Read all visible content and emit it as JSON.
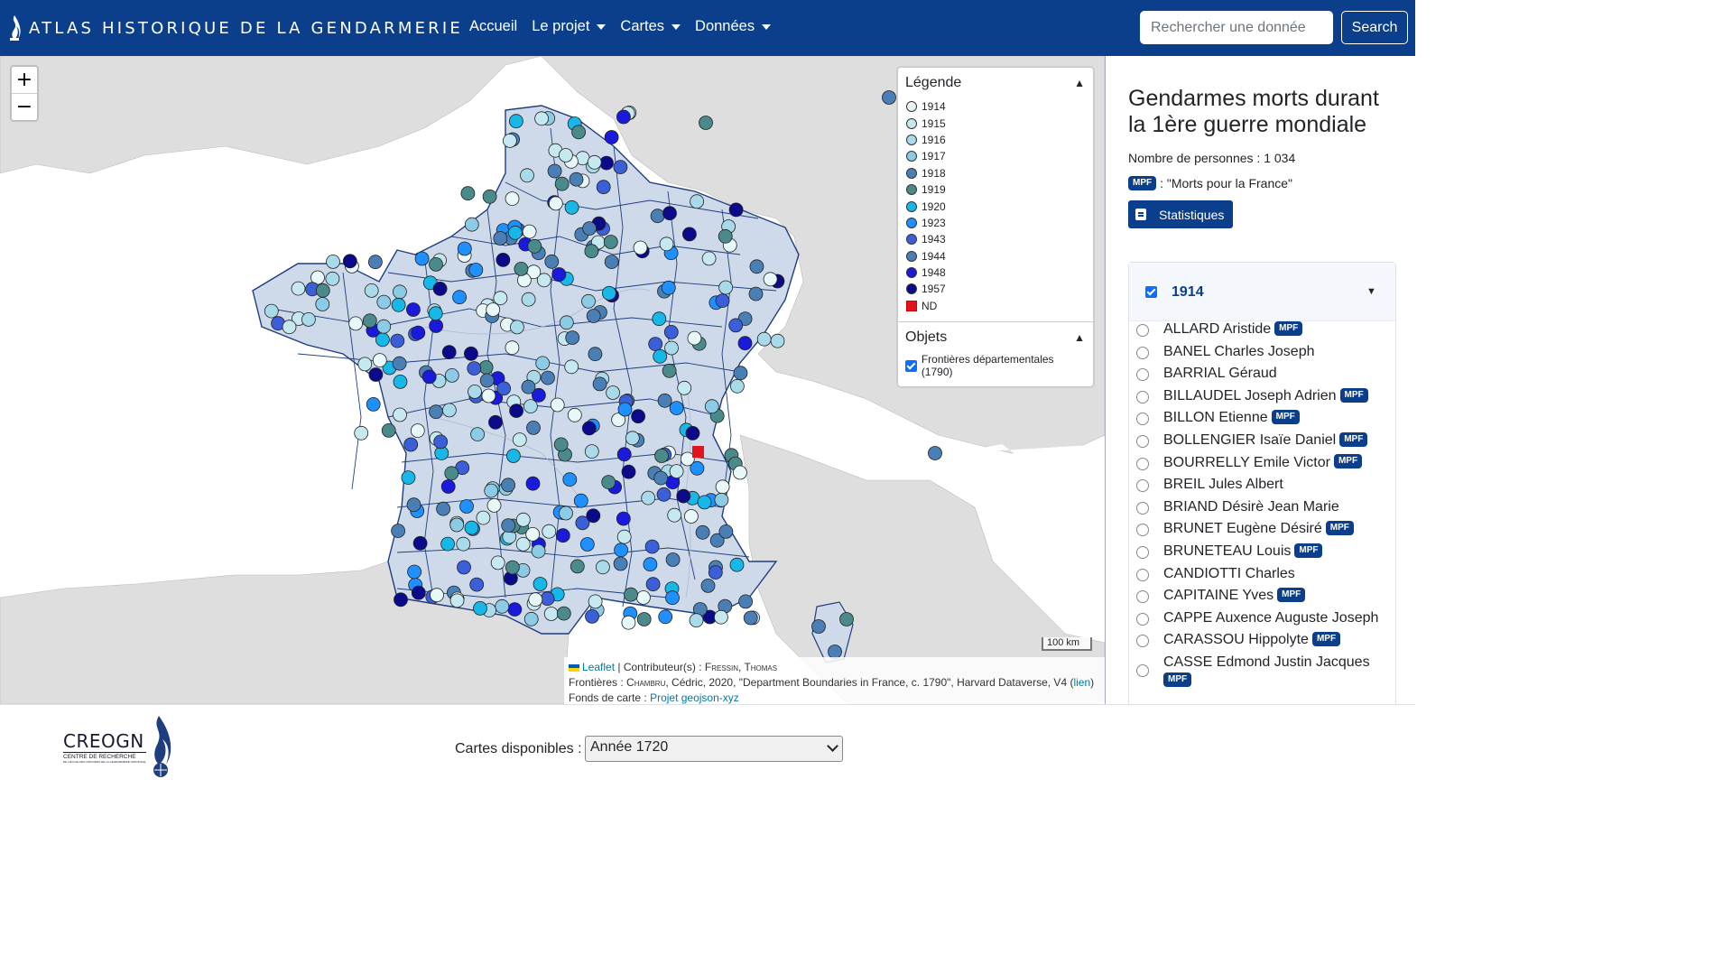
{
  "header": {
    "brand": "ATLAS HISTORIQUE DE LA GENDARMERIE",
    "nav": [
      {
        "label": "Accueil",
        "dropdown": false
      },
      {
        "label": "Le projet",
        "dropdown": true
      },
      {
        "label": "Cartes",
        "dropdown": true
      },
      {
        "label": "Données",
        "dropdown": true
      }
    ],
    "search_placeholder": "Rechercher une donnée",
    "search_button": "Search"
  },
  "map": {
    "zoom_in": "+",
    "zoom_out": "−",
    "legend": {
      "title": "Légende",
      "items": [
        {
          "label": "1914",
          "color": "#e8f7f7"
        },
        {
          "label": "1915",
          "color": "#c6e8f0"
        },
        {
          "label": "1916",
          "color": "#a8daea"
        },
        {
          "label": "1917",
          "color": "#8ccbe6"
        },
        {
          "label": "1918",
          "color": "#4a7fb5"
        },
        {
          "label": "1919",
          "color": "#4a8a8a"
        },
        {
          "label": "1920",
          "color": "#17b8e8"
        },
        {
          "label": "1923",
          "color": "#1e90ff"
        },
        {
          "label": "1943",
          "color": "#3a5fd8"
        },
        {
          "label": "1944",
          "color": "#4a7fb5"
        },
        {
          "label": "1948",
          "color": "#1a1adc"
        },
        {
          "label": "1957",
          "color": "#0a0a8a"
        },
        {
          "label": "ND",
          "color": "#e0141e",
          "square": true
        }
      ],
      "objects_title": "Objets",
      "objects": [
        {
          "label": "Frontières départementales (1790)",
          "checked": true
        }
      ]
    },
    "scale": "100 km",
    "attribution": {
      "leaflet": "Leaflet",
      "contrib_prefix": "| Contributeur(s) :",
      "contrib_name": "Fressin, Thomas",
      "frontieres_prefix": "Frontières :",
      "frontieres_author": "Chambru",
      "frontieres_text": ", Cédric, 2020, \"Department Boundaries in France, c. 1790\", Harvard Dataverse, V4 (",
      "lien": "lien",
      "close_paren": ")",
      "fonds_prefix": "Fonds de carte :",
      "fonds_link": "Projet geojson-xyz"
    }
  },
  "sidebar": {
    "title": "Gendarmes morts durant la 1ère guerre mondiale",
    "count": "Nombre de personnes : 1 034",
    "mpf_badge": "MPF",
    "mpf_text": ": \"Morts pour la France\"",
    "stats_button": "Statistiques",
    "accordion": {
      "year": "1914",
      "checked": true,
      "persons": [
        {
          "name": "ALLARD Aristide",
          "mpf": true
        },
        {
          "name": "BANEL Charles Joseph",
          "mpf": false
        },
        {
          "name": "BARRIAL Géraud",
          "mpf": false
        },
        {
          "name": "BILLAUDEL Joseph Adrien",
          "mpf": true
        },
        {
          "name": "BILLON Etienne",
          "mpf": true
        },
        {
          "name": "BOLLENGIER Isaïe Daniel",
          "mpf": true
        },
        {
          "name": "BOURRELLY Emile Victor",
          "mpf": true
        },
        {
          "name": "BREIL Jules Albert",
          "mpf": false
        },
        {
          "name": "BRIAND Désirè Jean Marie",
          "mpf": false
        },
        {
          "name": "BRUNET Eugène Désiré",
          "mpf": true
        },
        {
          "name": "BRUNETEAU Louis",
          "mpf": true
        },
        {
          "name": "CANDIOTTI Charles",
          "mpf": false
        },
        {
          "name": "CAPITAINE Yves",
          "mpf": true
        },
        {
          "name": "CAPPE Auxence Auguste Joseph",
          "mpf": false
        },
        {
          "name": "CARASSOU Hippolyte",
          "mpf": true
        },
        {
          "name": "CASSE Edmond Justin Jacques",
          "mpf": true,
          "wrap": true
        }
      ]
    }
  },
  "footer": {
    "logo_name": "CREOGN",
    "logo_sub1": "CENTRE DE RECHERCHE",
    "logo_sub2": "DE L'ÉCOLE DES OFFICIERS DE LA GENDARMERIE NATIONALE",
    "maps_label": "Cartes disponibles :",
    "maps_selected": "Année 1720"
  }
}
